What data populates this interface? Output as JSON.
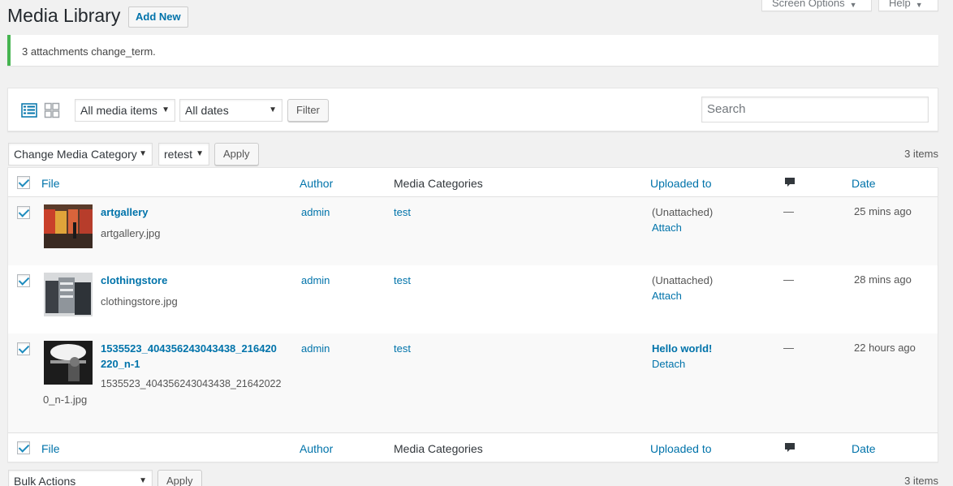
{
  "header": {
    "screen_options": "Screen Options",
    "help": "Help",
    "title": "Media Library",
    "add_new": "Add New"
  },
  "notice": {
    "text": "3 attachments change_term."
  },
  "filters": {
    "media_type": "All media items",
    "dates": "All dates",
    "filter_button": "Filter",
    "search_placeholder": "Search"
  },
  "top_actions": {
    "action": "Change Media Category",
    "term": "retest",
    "apply": "Apply",
    "count": "3 items"
  },
  "columns": {
    "file": "File",
    "author": "Author",
    "categories": "Media Categories",
    "uploaded_to": "Uploaded to",
    "date": "Date"
  },
  "rows": [
    {
      "title": "artgallery",
      "filename": "artgallery.jpg",
      "author": "admin",
      "category": "test",
      "uploaded_line1": "(Unattached)",
      "uploaded_line2": "Attach",
      "comments": "—",
      "date": "25 mins ago"
    },
    {
      "title": "clothingstore",
      "filename": "clothingstore.jpg",
      "author": "admin",
      "category": "test",
      "uploaded_line1": "(Unattached)",
      "uploaded_line2": "Attach",
      "comments": "—",
      "date": "28 mins ago"
    },
    {
      "title_line1": "1535523_404356243043438_216420",
      "title_line2": "220_n-1",
      "filename_line1": "1535523_404356243043438_21642022",
      "filename_line2": "0_n-1.jpg",
      "author": "admin",
      "category": "test",
      "uploaded_line1": "Hello world!",
      "uploaded_line2": "Detach",
      "comments": "—",
      "date": "22 hours ago"
    }
  ],
  "bottom_actions": {
    "action": "Bulk Actions",
    "apply": "Apply",
    "count": "3 items"
  },
  "colors": {
    "accent": "#0073aa",
    "success": "#46b450",
    "checkbox": "#1e8cbe"
  }
}
